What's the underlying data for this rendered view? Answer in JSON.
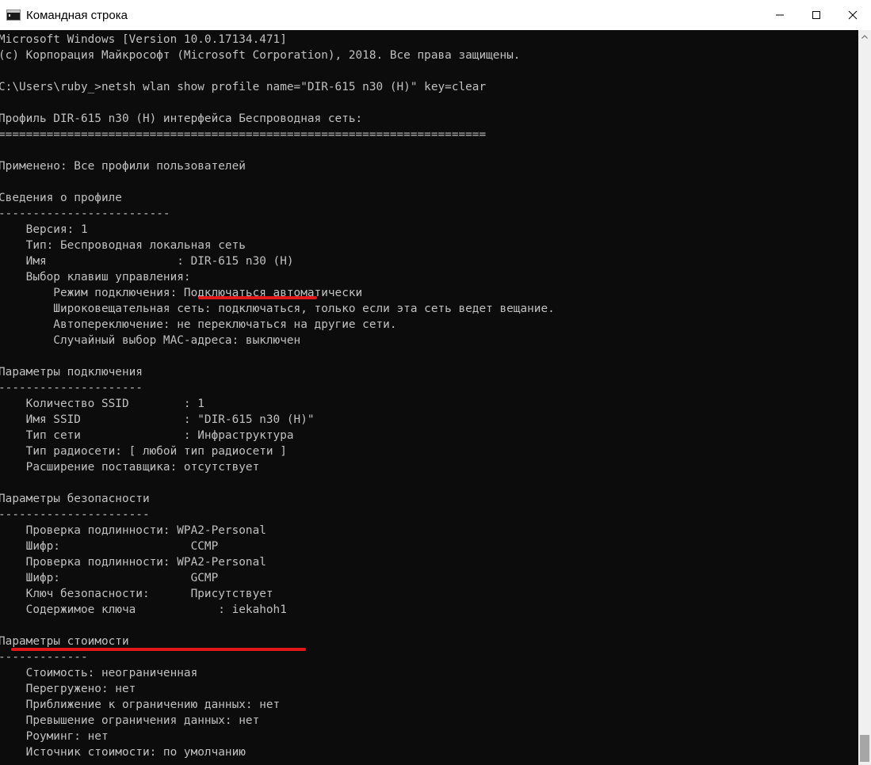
{
  "window": {
    "title": "Командная строка",
    "icon": "cmd-icon"
  },
  "controls": {
    "minimize_icon": "minimize-icon",
    "maximize_icon": "maximize-icon",
    "close_icon": "close-icon"
  },
  "console": {
    "lines": [
      "Microsoft Windows [Version 10.0.17134.471]",
      "(c) Корпорация Майкрософт (Microsoft Corporation), 2018. Все права защищены.",
      "",
      "C:\\Users\\ruby_>netsh wlan show profile name=\"DIR-615 n30 (H)\" key=clear",
      "",
      "Профиль DIR-615 n30 (H) интерфейса Беспроводная сеть:",
      "=======================================================================",
      "",
      "Применено: Все профили пользователей",
      "",
      "Сведения о профиле",
      "-------------------------",
      "    Версия: 1",
      "    Тип: Беспроводная локальная сеть",
      "    Имя                   : DIR-615 n30 (H)",
      "    Выбор клавиш управления:",
      "        Режим подключения: Подключаться автоматически",
      "        Широковещательная сеть: подключаться, только если эта сеть ведет вещание.",
      "        Автопереключение: не переключаться на другие сети.",
      "        Случайный выбор MAC-адреса: выключен",
      "",
      "Параметры подключения",
      "---------------------",
      "    Количество SSID        : 1",
      "    Имя SSID               : \"DIR-615 n30 (H)\"",
      "    Тип сети               : Инфраструктура",
      "    Тип радиосети: [ любой тип радиосети ]",
      "    Расширение поставщика: отсутствует",
      "",
      "Параметры безопасности",
      "----------------------",
      "    Проверка подлинности: WPA2-Personal",
      "    Шифр:                   CCMP",
      "    Проверка подлинности: WPA2-Personal",
      "    Шифр:                   GCMP",
      "    Ключ безопасности:      Присутствует",
      "    Содержимое ключа            : iekahoh1",
      "",
      "Параметры стоимости",
      "-------------",
      "    Стоимость: неограниченная",
      "    Перегружено: нет",
      "    Приближение к ограничению данных: нет",
      "    Превышение ограничения данных: нет",
      "    Роуминг: нет",
      "    Источник стоимости: по умолчанию"
    ]
  },
  "colors": {
    "console_background": "#0c0c0c",
    "console_text": "#c0c0c0",
    "titlebar_background": "#ffffff",
    "highlight_underline": "#e0161b",
    "scrollbar_track": "#f0f0f0",
    "scrollbar_thumb": "#a6a6a6"
  },
  "annotations": {
    "profile_name_underline": "red-underline-mark",
    "key_content_underline": "red-underline-mark"
  }
}
